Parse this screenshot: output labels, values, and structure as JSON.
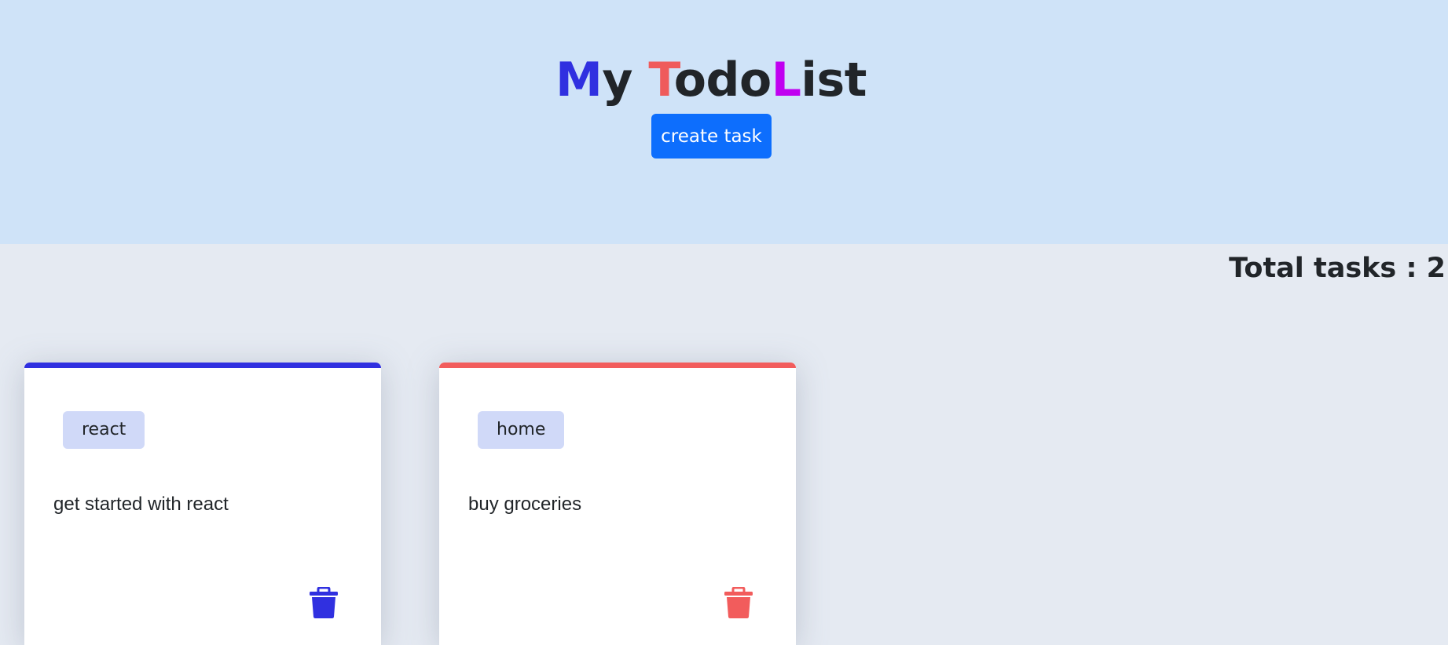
{
  "header": {
    "title_parts": [
      {
        "text": "M",
        "color": "#3030e0"
      },
      {
        "text": "y ",
        "color": "#212529"
      },
      {
        "text": "T",
        "color": "#ef5b5b"
      },
      {
        "text": "odo",
        "color": "#212529"
      },
      {
        "text": "L",
        "color": "#c000f0"
      },
      {
        "text": "ist",
        "color": "#212529"
      }
    ],
    "create_button_label": "create task"
  },
  "summary": {
    "total_label": "Total tasks : 2"
  },
  "tasks": [
    {
      "tag": "react",
      "text": "get started with react",
      "accent": "#3030e0",
      "icon": "trash-icon"
    },
    {
      "tag": "home",
      "text": "buy groceries",
      "accent": "#f25c5c",
      "icon": "trash-icon"
    }
  ]
}
